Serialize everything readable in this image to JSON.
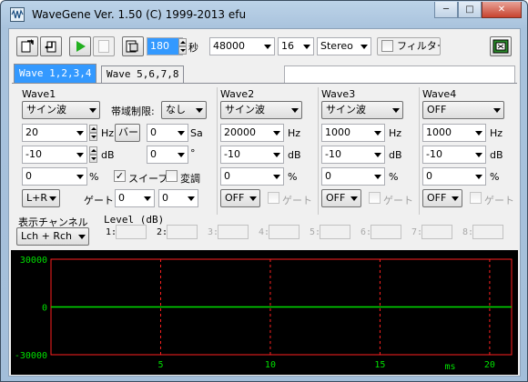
{
  "window": {
    "title": "WaveGene  Ver. 1.50  (C) 1999-2013 efu",
    "min_glyph": "─",
    "max_glyph": "□",
    "close_glyph": "✕"
  },
  "toolbar": {
    "duration_value": "180",
    "duration_unit": "秒",
    "sample_rate": "48000",
    "bit_depth": "16",
    "channels": "Stereo",
    "filter_label": "フィルター"
  },
  "tabs": [
    {
      "label": "Wave 1,2,3,4",
      "active": true
    },
    {
      "label": "Wave 5,6,7,8",
      "active": false
    }
  ],
  "wave1": {
    "title": "Wave1",
    "waveform": "サイン波",
    "band_limit_label": "帯域制限:",
    "band_limit_value": "なし",
    "frequency": "20",
    "freq_unit": "Hz",
    "bar_button": "バー",
    "sa_value": "0",
    "sa_unit": "Sa",
    "level": "-10",
    "level_unit": "dB",
    "phase": "0",
    "phase_unit": "°",
    "offset": "0",
    "offset_unit": "%",
    "sweep_label": "スイープ",
    "sweep_checked": true,
    "modulation_label": "変調",
    "modulation_checked": false,
    "channel": "L+R",
    "gate_label": "ゲート:",
    "gate_a": "0",
    "gate_b": "0"
  },
  "waves": [
    {
      "title": "Wave2",
      "waveform": "サイン波",
      "frequency": "20000",
      "level": "-10",
      "offset": "0",
      "mode": "OFF",
      "gate_label": "ゲート"
    },
    {
      "title": "Wave3",
      "waveform": "サイン波",
      "frequency": "1000",
      "level": "-10",
      "offset": "0",
      "mode": "OFF",
      "gate_label": "ゲート"
    },
    {
      "title": "Wave4",
      "waveform": "OFF",
      "frequency": "1000",
      "level": "-10",
      "offset": "0",
      "mode": "OFF",
      "gate_label": "ゲート"
    }
  ],
  "units": {
    "hz": "Hz",
    "db": "dB",
    "percent": "%"
  },
  "display": {
    "channel_label": "表示チャンネル",
    "channel_value": "Lch + Rch",
    "level_label": "Level (dB)",
    "level_slots": [
      "1:",
      "2:",
      "3:",
      "4:",
      "5:",
      "6:",
      "7:",
      "8:"
    ]
  },
  "scope": {
    "background": "#000000",
    "grid_color": "#ff2020",
    "trace_color": "#00e000",
    "label_color": "#00e000",
    "y_labels": [
      "30000",
      "0",
      "-30000"
    ],
    "x_labels": [
      "5",
      "10",
      "15",
      "20"
    ],
    "x_unit": "ms",
    "x_range": [
      0,
      21
    ],
    "y_range": [
      -30000,
      30000
    ],
    "trace_value": 0
  }
}
